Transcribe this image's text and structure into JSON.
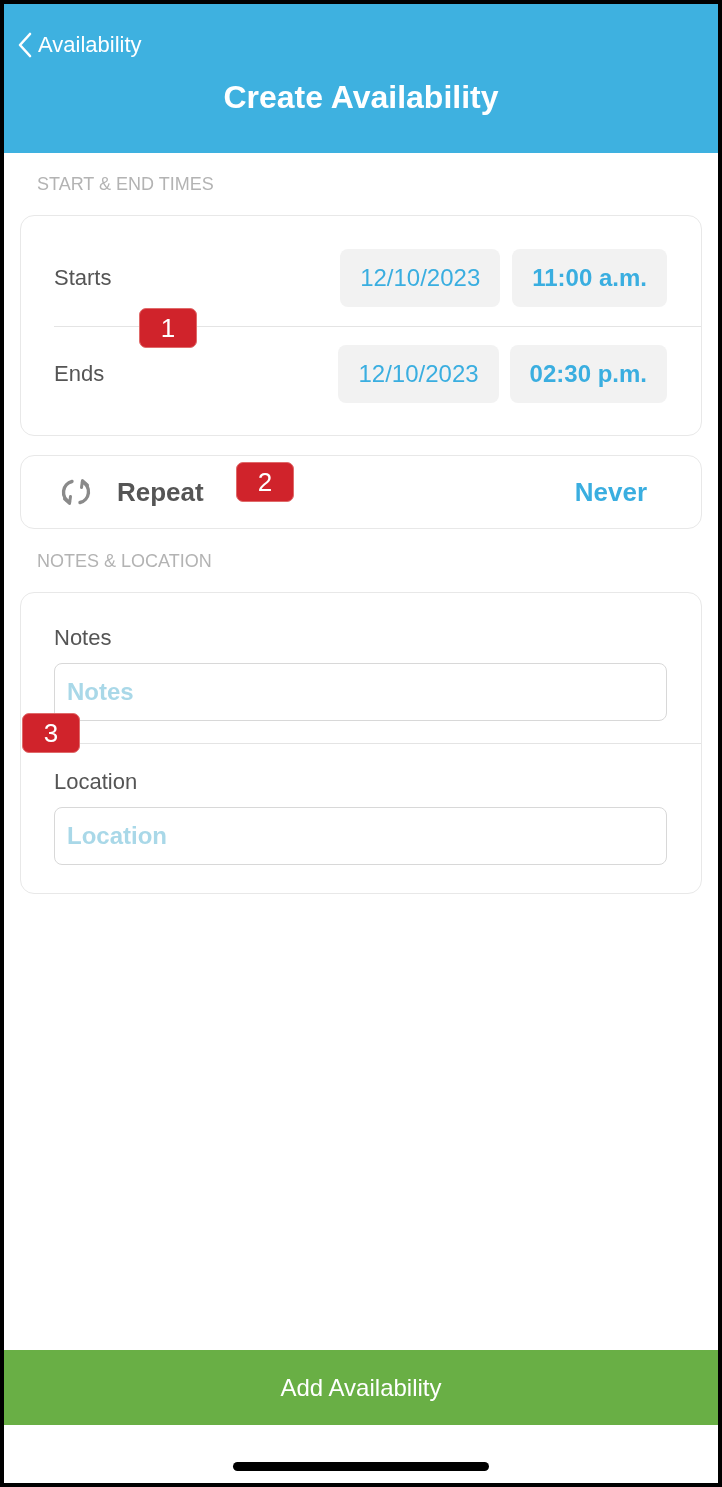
{
  "header": {
    "back_label": "Availability",
    "title": "Create Availability"
  },
  "times_section": {
    "heading": "START & END TIMES",
    "callout": "1",
    "rows": [
      {
        "label": "Starts",
        "date": "12/10/2023",
        "time": "11:00 a.m."
      },
      {
        "label": "Ends",
        "date": "12/10/2023",
        "time": "02:30 p.m."
      }
    ]
  },
  "repeat": {
    "label": "Repeat",
    "value": "Never",
    "callout": "2"
  },
  "notes_section": {
    "heading": "NOTES & LOCATION",
    "callout": "3",
    "fields": [
      {
        "label": "Notes",
        "placeholder": "Notes"
      },
      {
        "label": "Location",
        "placeholder": "Location"
      }
    ]
  },
  "primary_button": {
    "label": "Add Availability"
  }
}
